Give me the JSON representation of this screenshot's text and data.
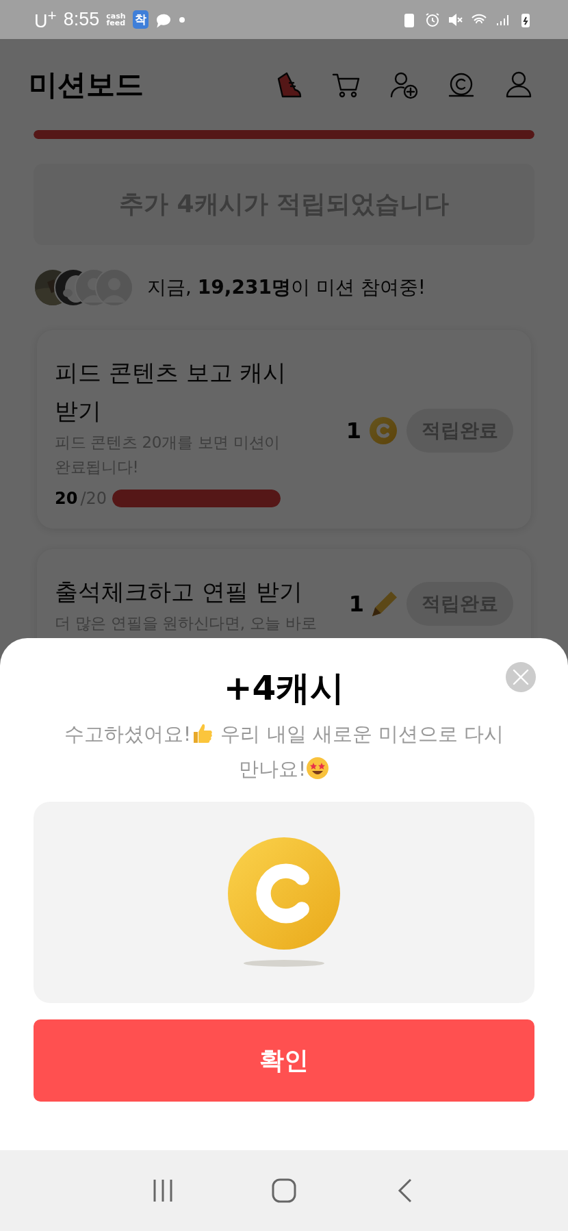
{
  "status_bar": {
    "carrier": "U$^{+}$",
    "time": "8:55",
    "app_logo": "cash\nfeed",
    "app_badge": "착"
  },
  "header": {
    "title": "미션보드",
    "progress": {
      "level": 1
    }
  },
  "notice": "추가 4캐시가 적립되었습니다",
  "participants": {
    "avatars": [
      {
        "kind": "picture"
      },
      {
        "kind": "picture"
      },
      {
        "kind": "placeholder"
      },
      {
        "kind": "placeholder"
      }
    ],
    "text": "지금, **19,231명**이 미션 참여중!"
  },
  "missions": [
    {
      "title": "피드 콘텐츠 보고 캐시 받기",
      "description": "피드 콘텐츠 20개를 보면 미션이 완료됩니다!",
      "progress": {
        "done": "20",
        "total": "/20",
        "level": 1
      },
      "reward": {
        "amount": "1",
        "kind": "cash"
      },
      "button": "적립완료"
    },
    {
      "title": "출석체크하고 연필 받기",
      "description": "더 많은 연필을 원하신다면, 오늘 바로",
      "reward": {
        "amount": "1",
        "kind": "pencil"
      },
      "button": "적립완료"
    }
  ],
  "sheet": {
    "title": "+4캐시",
    "message": [
      {
        "kind": "text",
        "text": "수고하셨어요!"
      },
      {
        "kind": "thumbs_up"
      },
      {
        "kind": "text",
        "text": " 우리 내일 새로운 미션으로 다시 만나요!"
      },
      {
        "kind": "star_eyes"
      }
    ],
    "button": "확인"
  }
}
